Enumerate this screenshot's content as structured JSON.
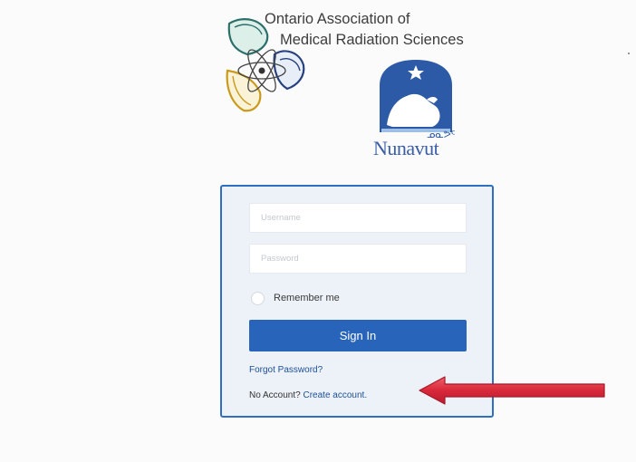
{
  "header": {
    "org_line1": "Ontario Association of",
    "org_line2": "Medical Radiation Sciences",
    "nunavut_syllabics": "ᓄᓇᕗᑦ",
    "nunavut_name": "Nunavut",
    "org_logo_icon": "atom-trefoil-logo-icon",
    "crest_icon": "polar-bear-crest-icon"
  },
  "login": {
    "username_placeholder": "Username",
    "password_placeholder": "Password",
    "remember_label": "Remember me",
    "signin_label": "Sign In",
    "forgot_label": "Forgot Password?",
    "no_account_label": "No Account?",
    "create_account_label": "Create account."
  },
  "annotation": {
    "arrow_icon": "red-arrow-icon",
    "arrow_color": "#d8283a"
  },
  "colors": {
    "accent": "#2864b9",
    "card_border": "#2f6fc1",
    "card_background": "#ecf2f8",
    "link": "#1d4f99"
  }
}
